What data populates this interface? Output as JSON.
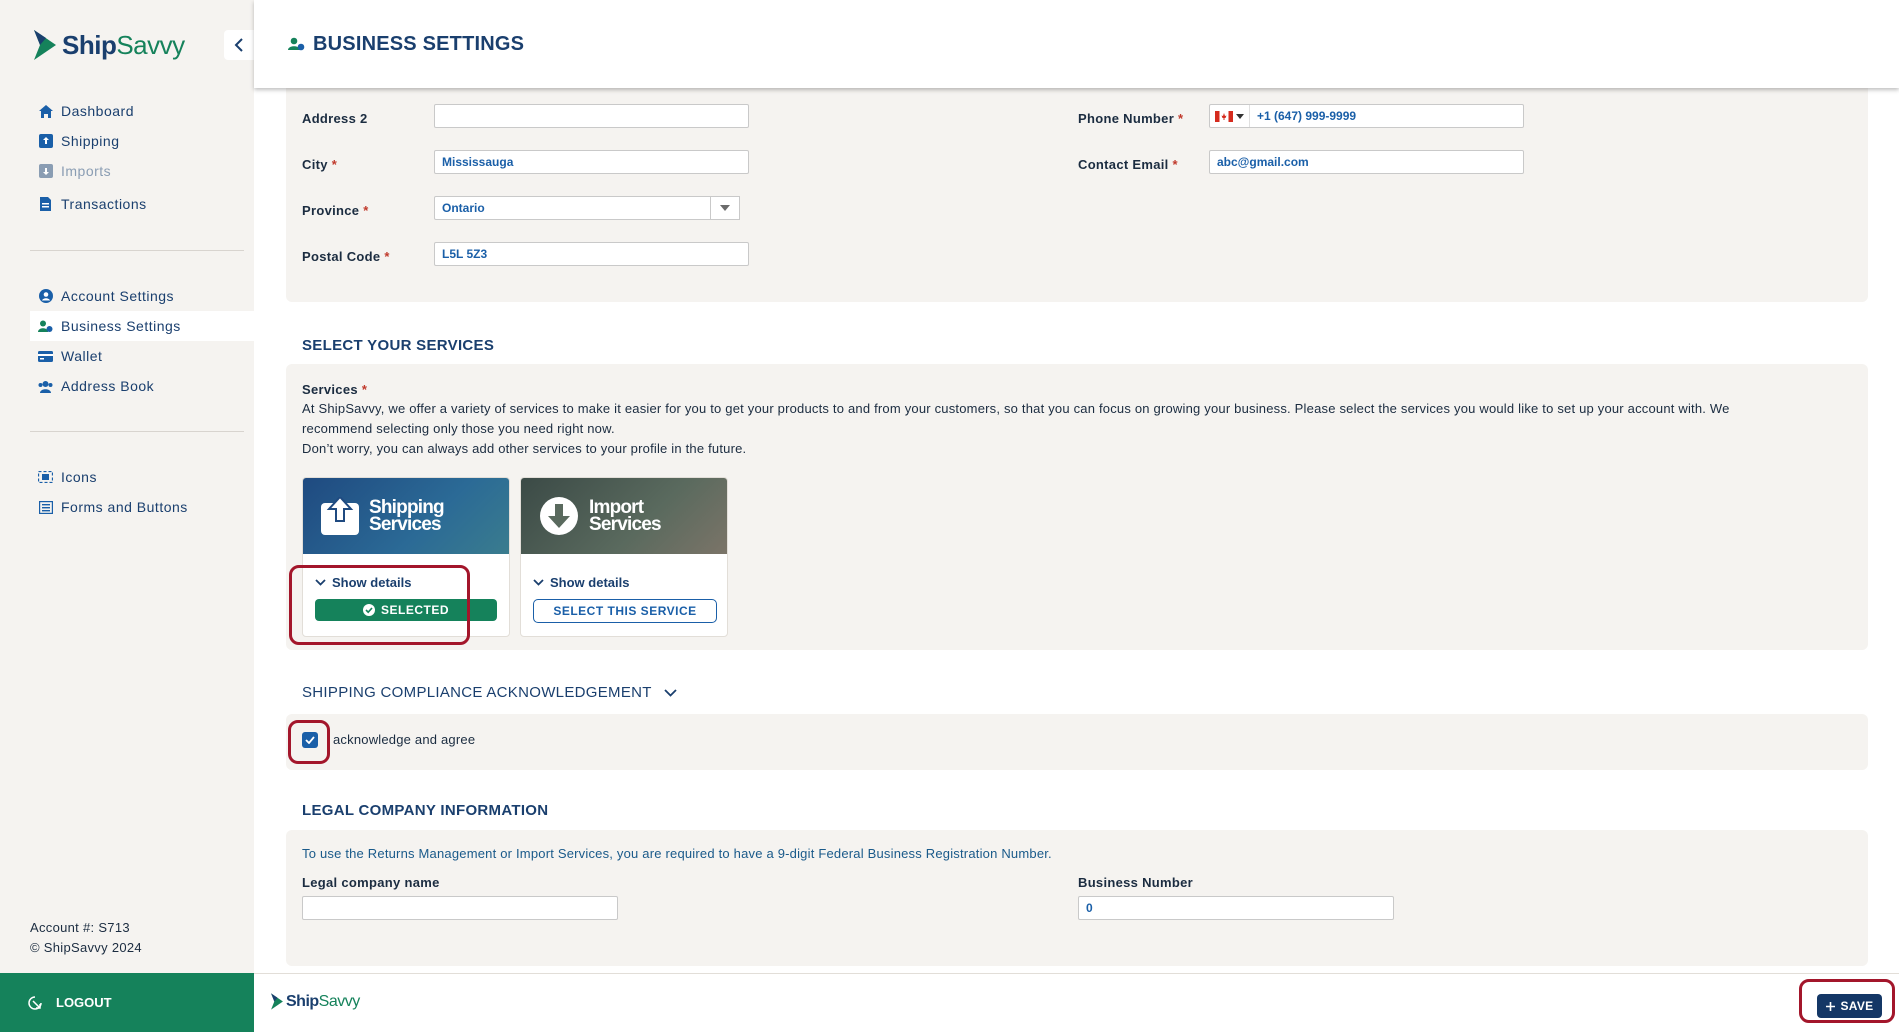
{
  "app": {
    "logo_ship": "Ship",
    "logo_savvy": "Savvy"
  },
  "sidebar": {
    "groups": [
      [
        {
          "label": "Dashboard",
          "icon": "home-icon",
          "disabled": false,
          "active": false
        },
        {
          "label": "Shipping",
          "icon": "shipping-box-icon",
          "disabled": false,
          "active": false
        },
        {
          "label": "Imports",
          "icon": "import-box-icon",
          "disabled": true,
          "active": false
        },
        {
          "label": "Transactions",
          "icon": "document-icon",
          "disabled": false,
          "active": false
        }
      ],
      [
        {
          "label": "Account Settings",
          "icon": "user-circle-icon",
          "disabled": false,
          "active": false
        },
        {
          "label": "Business Settings",
          "icon": "business-users-icon",
          "disabled": false,
          "active": true
        },
        {
          "label": "Wallet",
          "icon": "wallet-card-icon",
          "disabled": false,
          "active": false
        },
        {
          "label": "Address Book",
          "icon": "address-book-icon",
          "disabled": false,
          "active": false
        }
      ],
      [
        {
          "label": "Icons",
          "icon": "icons-grid-icon",
          "disabled": false,
          "active": false
        },
        {
          "label": "Forms and Buttons",
          "icon": "forms-list-icon",
          "disabled": false,
          "active": false
        }
      ]
    ],
    "account_number": "Account #: S713",
    "copyright": "© ShipSavvy 2024",
    "logout_label": "LOGOUT"
  },
  "header": {
    "title": "BUSINESS SETTINGS"
  },
  "address": {
    "address2": {
      "label": "Address 2",
      "value": ""
    },
    "city": {
      "label": "City",
      "value": "Mississauga"
    },
    "province": {
      "label": "Province",
      "value": "Ontario"
    },
    "postal": {
      "label": "Postal Code",
      "value": "L5L 5Z3"
    },
    "phone": {
      "label": "Phone Number",
      "value": "+1 (647) 999-9999"
    },
    "email": {
      "label": "Contact Email",
      "value": "abc@gmail.com"
    },
    "required_mark": "*"
  },
  "services": {
    "section_title": "SELECT YOUR SERVICES",
    "label": "Services",
    "description_line1": "At ShipSavvy, we offer a variety of services to make it easier for you to get your products to and from your customers, so that you can focus on growing your business. Please select the services you would like to set up your account with. We",
    "description_line2": "recommend selecting only those you need right now.",
    "description_line3": "Don’t worry, you can always add other services to your profile in the future.",
    "cards": [
      {
        "title_line1": "Shipping",
        "title_line2": "Services",
        "show_details": "Show details",
        "button": "SELECTED",
        "selected": true
      },
      {
        "title_line1": "Import",
        "title_line2": "Services",
        "show_details": "Show details",
        "button": "SELECT THIS SERVICE",
        "selected": false
      }
    ]
  },
  "compliance": {
    "section_title": "SHIPPING COMPLIANCE ACKNOWLEDGEMENT",
    "checkbox_label": "acknowledge and agree",
    "checked": true
  },
  "legal": {
    "section_title": "LEGAL COMPANY INFORMATION",
    "note": "To use the Returns Management or Import Services, you are required to have a 9-digit Federal Business Registration Number.",
    "company_name": {
      "label": "Legal company name",
      "value": ""
    },
    "business_number": {
      "label": "Business Number",
      "value": "0"
    }
  },
  "footer": {
    "logo_ship": "Ship",
    "logo_savvy": "Savvy",
    "save_label": "SAVE"
  },
  "colors": {
    "brand_navy": "#1a3f6e",
    "brand_green": "#15825b",
    "highlight_red": "#a3162b",
    "link_blue": "#1a5fa8"
  }
}
